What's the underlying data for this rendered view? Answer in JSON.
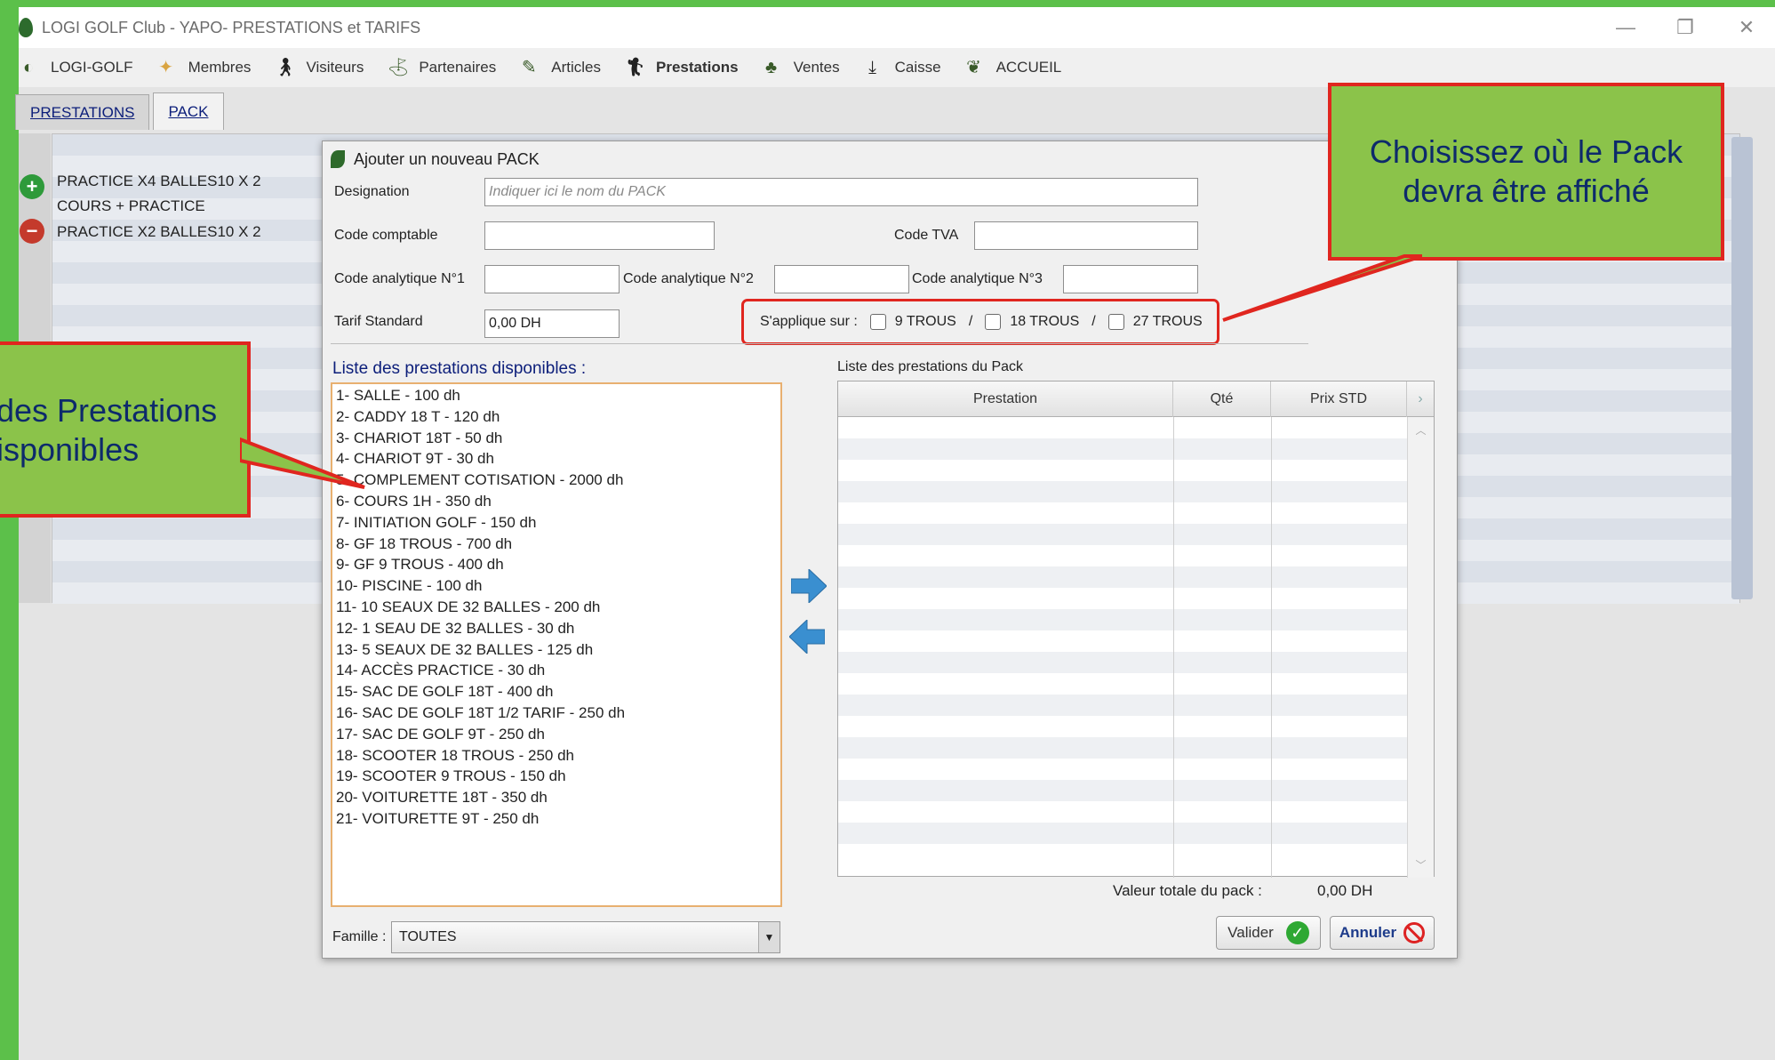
{
  "window": {
    "title": "LOGI GOLF Club - YAPO- PRESTATIONS et TARIFS"
  },
  "menu": [
    {
      "label": "LOGI-GOLF",
      "icon": "golf-ball-icon"
    },
    {
      "label": "Membres",
      "icon": "members-icon"
    },
    {
      "label": "Visiteurs",
      "icon": "walker-icon"
    },
    {
      "label": "Partenaires",
      "icon": "partners-icon"
    },
    {
      "label": "Articles",
      "icon": "articles-icon"
    },
    {
      "label": "Prestations",
      "icon": "golfer-icon"
    },
    {
      "label": "Ventes",
      "icon": "sales-icon"
    },
    {
      "label": "Caisse",
      "icon": "download-icon"
    },
    {
      "label": "ACCUEIL",
      "icon": "home-leaf-icon"
    }
  ],
  "tabs": [
    "PRESTATIONS",
    "PACK"
  ],
  "packs": [
    "PRACTICE X4 BALLES10 X 2",
    "COURS + PRACTICE",
    "PRACTICE X2 BALLES10 X 2"
  ],
  "dialog": {
    "title": "Ajouter un nouveau PACK",
    "designation_label": "Designation",
    "designation_placeholder": "Indiquer ici le nom du PACK",
    "code_comptable_label": "Code comptable",
    "code_tva_label": "Code TVA",
    "code_analytique_1_label": "Code analytique N°1",
    "code_analytique_2_label": "Code analytique N°2",
    "code_analytique_3_label": "Code analytique N°3",
    "tarif_label": "Tarif Standard",
    "tarif_value": "0,00 DH",
    "applies_label": "S'applique sur :",
    "applies_options": [
      "9 TROUS",
      "18 TROUS",
      "27 TROUS"
    ],
    "applies_sep": "/",
    "available_title": "Liste des prestations disponibles :",
    "available": [
      "1- SALLE  -  100 dh",
      "2- CADDY 18 T  -  120 dh",
      "3- CHARIOT 18T  -  50 dh",
      "4- CHARIOT 9T  -  30 dh",
      "5- COMPLEMENT COTISATION  -  2000 dh",
      "6- COURS 1H  -  350 dh",
      "7- INITIATION GOLF  -  150 dh",
      "8- GF 18 TROUS  -  700 dh",
      "9- GF 9 TROUS  -  400 dh",
      "10- PISCINE  -  100 dh",
      "11- 10 SEAUX DE 32 BALLES  -  200 dh",
      "12- 1 SEAU DE 32 BALLES  -  30 dh",
      "13- 5 SEAUX DE 32 BALLES  -  125 dh",
      "14- ACCÈS PRACTICE  -  30 dh",
      "15- SAC DE GOLF 18T  -  400 dh",
      "16- SAC DE GOLF 18T 1/2 TARIF  -  250 dh",
      "17- SAC DE GOLF 9T  -  250 dh",
      "18- SCOOTER 18 TROUS  -  250 dh",
      "19- SCOOTER 9 TROUS  -  150 dh",
      "20- VOITURETTE 18T  -  350 dh",
      "21- VOITURETTE 9T  -  250 dh"
    ],
    "pack_title": "Liste des prestations du Pack",
    "columns": [
      "Prestation",
      "Qté",
      "Prix STD"
    ],
    "total_label": "Valeur totale du pack :",
    "total_value": "0,00 DH",
    "famille_label": "Famille :",
    "famille_value": "TOUTES",
    "valider_label": "Valider",
    "annuler_label": "Annuler"
  },
  "callouts": {
    "right": "Choisissez où le Pack devra être affiché",
    "left_line1": "des Prestations",
    "left_line2": "isponibles"
  },
  "colors": {
    "accent_green": "#8bc34a",
    "callout_border": "#e0261f",
    "link_blue": "#0c1e7a"
  }
}
